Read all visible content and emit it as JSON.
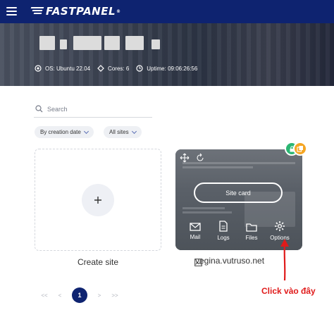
{
  "header": {
    "brand": "FASTPANEL",
    "trademark": "®",
    "menu_icon": "hamburger-icon"
  },
  "server": {
    "os": "OS: Ubuntu 22.04",
    "cores": "Cores: 6",
    "uptime": "Uptime: 09:06:26:56"
  },
  "search": {
    "placeholder": "Search"
  },
  "filters": {
    "sort_label": "By creation date",
    "scope_label": "All sites"
  },
  "create": {
    "label": "Create site"
  },
  "site": {
    "button_label": "Site card",
    "actions": [
      {
        "label": "Mail",
        "icon": "mail-icon"
      },
      {
        "label": "Logs",
        "icon": "document-icon"
      },
      {
        "label": "Files",
        "icon": "folder-icon"
      },
      {
        "label": "Options",
        "icon": "gear-icon"
      }
    ],
    "url": "vegina.vutruso.net",
    "badge_colors": {
      "green": "#2bb673",
      "orange": "#f5a623"
    }
  },
  "pagination": {
    "first": "<<",
    "prev": "<",
    "current": "1",
    "next": ">",
    "last": ">>"
  },
  "annotation": {
    "text": "Click vào đây",
    "color": "#e01b1b"
  },
  "colors": {
    "brand": "#0e2370"
  }
}
